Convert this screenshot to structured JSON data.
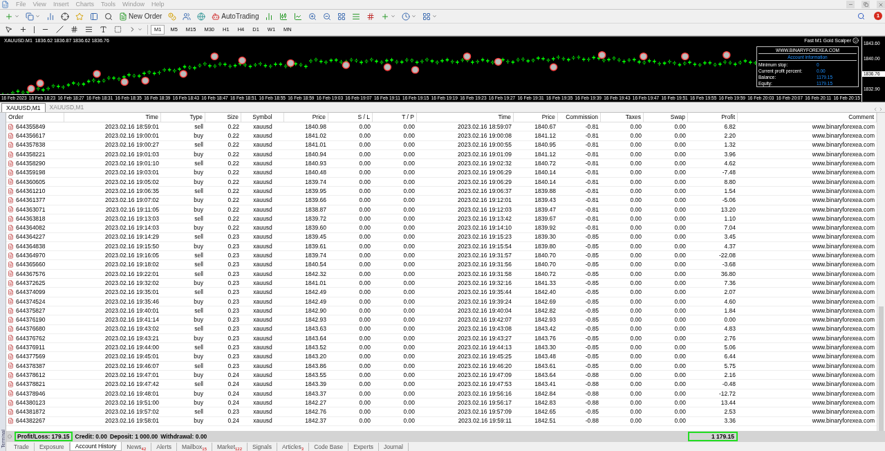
{
  "menu": [
    {
      "label": "File"
    },
    {
      "label": "View"
    },
    {
      "label": "Insert"
    },
    {
      "label": "Charts"
    },
    {
      "label": "Tools"
    },
    {
      "label": "Window"
    },
    {
      "label": "Help"
    }
  ],
  "notifications": {
    "count": "1"
  },
  "toolbar": {
    "new_order": "New Order",
    "auto_trading": "AutoTrading"
  },
  "timeframes": [
    {
      "label": "M1",
      "selected": true
    },
    {
      "label": "M5",
      "selected": false
    },
    {
      "label": "M15",
      "selected": false
    },
    {
      "label": "M30",
      "selected": false
    },
    {
      "label": "H1",
      "selected": false
    },
    {
      "label": "H4",
      "selected": false
    },
    {
      "label": "D1",
      "selected": false
    },
    {
      "label": "W1",
      "selected": false
    },
    {
      "label": "MN",
      "selected": false
    }
  ],
  "chart": {
    "header": "XAUUSD.M1  1836.62 1836.87 1836.62 1836.76",
    "expert": "Fast M1 Gold Scalper",
    "prices": [
      {
        "label": "1843.60",
        "current": false
      },
      {
        "label": "1840.00",
        "current": false
      },
      {
        "label": "1836.76",
        "current": true
      },
      {
        "label": "1832.90",
        "current": false
      }
    ],
    "times": [
      "16 Feb 2023",
      "16 Feb 18:23",
      "16 Feb 18:27",
      "16 Feb 18:31",
      "16 Feb 18:35",
      "16 Feb 18:39",
      "16 Feb 18:43",
      "16 Feb 18:47",
      "16 Feb 18:51",
      "16 Feb 18:55",
      "16 Feb 18:59",
      "16 Feb 19:03",
      "16 Feb 19:07",
      "16 Feb 19:11",
      "16 Feb 19:15",
      "16 Feb 19:19",
      "16 Feb 19:23",
      "16 Feb 19:27",
      "16 Feb 19:31",
      "16 Feb 19:35",
      "16 Feb 19:39",
      "16 Feb 19:43",
      "16 Feb 19:47",
      "16 Feb 19:51",
      "16 Feb 19:55",
      "16 Feb 19:59",
      "16 Feb 20:03",
      "16 Feb 20:07",
      "16 Feb 20:11",
      "16 Feb 20:15"
    ],
    "panel": {
      "site": "WWW.BINARYFOREXEA.COM",
      "heading": "Account information",
      "fields": [
        {
          "label": "Minimum stop:",
          "value": "0"
        },
        {
          "label": "Current profit percent:",
          "value": "0.00"
        },
        {
          "label": "Balance:",
          "value": "1179.15"
        },
        {
          "label": "Equity:",
          "value": "1179.15"
        }
      ]
    }
  },
  "chart_tabs": [
    {
      "label": "XAUUSD,M1",
      "selected": true
    },
    {
      "label": "XAUUSD,M1",
      "selected": false
    }
  ],
  "table": {
    "columns": [
      "Order",
      "Time",
      "Type",
      "Size",
      "Symbol",
      "Price",
      "S / L",
      "T / P",
      "Time",
      "Price",
      "Commission",
      "Taxes",
      "Swap",
      "Profit",
      "Comment"
    ],
    "rows": [
      [
        "644355849",
        "2023.02.16 18:59:01",
        "sell",
        "0.22",
        "xauusd",
        "1840.98",
        "0.00",
        "0.00",
        "2023.02.16 18:59:07",
        "1840.67",
        "-0.81",
        "0.00",
        "0.00",
        "6.82",
        "www.binaryforexea.com"
      ],
      [
        "644356617",
        "2023.02.16 19:00:01",
        "buy",
        "0.22",
        "xauusd",
        "1841.02",
        "0.00",
        "0.00",
        "2023.02.16 19:00:08",
        "1841.12",
        "-0.81",
        "0.00",
        "0.00",
        "2.20",
        "www.binaryforexea.com"
      ],
      [
        "644357838",
        "2023.02.16 19:00:27",
        "sell",
        "0.22",
        "xauusd",
        "1841.01",
        "0.00",
        "0.00",
        "2023.02.16 19:00:55",
        "1840.95",
        "-0.81",
        "0.00",
        "0.00",
        "1.32",
        "www.binaryforexea.com"
      ],
      [
        "644358221",
        "2023.02.16 19:01:03",
        "buy",
        "0.22",
        "xauusd",
        "1840.94",
        "0.00",
        "0.00",
        "2023.02.16 19:01:09",
        "1841.12",
        "-0.81",
        "0.00",
        "0.00",
        "3.96",
        "www.binaryforexea.com"
      ],
      [
        "644358290",
        "2023.02.16 19:01:10",
        "sell",
        "0.22",
        "xauusd",
        "1840.93",
        "0.00",
        "0.00",
        "2023.02.16 19:02:32",
        "1840.72",
        "-0.81",
        "0.00",
        "0.00",
        "4.62",
        "www.binaryforexea.com"
      ],
      [
        "644359198",
        "2023.02.16 19:03:01",
        "buy",
        "0.22",
        "xauusd",
        "1840.48",
        "0.00",
        "0.00",
        "2023.02.16 19:06:29",
        "1840.14",
        "-0.81",
        "0.00",
        "0.00",
        "-7.48",
        "www.binaryforexea.com"
      ],
      [
        "644360605",
        "2023.02.16 19:05:02",
        "buy",
        "0.22",
        "xauusd",
        "1839.74",
        "0.00",
        "0.00",
        "2023.02.16 19:06:29",
        "1840.14",
        "-0.81",
        "0.00",
        "0.00",
        "8.80",
        "www.binaryforexea.com"
      ],
      [
        "644361210",
        "2023.02.16 19:06:35",
        "sell",
        "0.22",
        "xauusd",
        "1839.95",
        "0.00",
        "0.00",
        "2023.02.16 19:06:37",
        "1839.88",
        "-0.81",
        "0.00",
        "0.00",
        "1.54",
        "www.binaryforexea.com"
      ],
      [
        "644361377",
        "2023.02.16 19:07:02",
        "buy",
        "0.22",
        "xauusd",
        "1839.66",
        "0.00",
        "0.00",
        "2023.02.16 19:12:01",
        "1839.43",
        "-0.81",
        "0.00",
        "0.00",
        "-5.06",
        "www.binaryforexea.com"
      ],
      [
        "644363071",
        "2023.02.16 19:11:05",
        "buy",
        "0.22",
        "xauusd",
        "1838.87",
        "0.00",
        "0.00",
        "2023.02.16 19:12:03",
        "1839.47",
        "-0.81",
        "0.00",
        "0.00",
        "13.20",
        "www.binaryforexea.com"
      ],
      [
        "644363818",
        "2023.02.16 19:13:03",
        "sell",
        "0.22",
        "xauusd",
        "1839.72",
        "0.00",
        "0.00",
        "2023.02.16 19:13:42",
        "1839.67",
        "-0.81",
        "0.00",
        "0.00",
        "1.10",
        "www.binaryforexea.com"
      ],
      [
        "644364082",
        "2023.02.16 19:14:03",
        "buy",
        "0.22",
        "xauusd",
        "1839.60",
        "0.00",
        "0.00",
        "2023.02.16 19:14:10",
        "1839.92",
        "-0.81",
        "0.00",
        "0.00",
        "7.04",
        "www.binaryforexea.com"
      ],
      [
        "644364227",
        "2023.02.16 19:14:29",
        "sell",
        "0.23",
        "xauusd",
        "1839.45",
        "0.00",
        "0.00",
        "2023.02.16 19:15:23",
        "1839.30",
        "-0.85",
        "0.00",
        "0.00",
        "3.45",
        "www.binaryforexea.com"
      ],
      [
        "644364838",
        "2023.02.16 19:15:50",
        "buy",
        "0.23",
        "xauusd",
        "1839.61",
        "0.00",
        "0.00",
        "2023.02.16 19:15:54",
        "1839.80",
        "-0.85",
        "0.00",
        "0.00",
        "4.37",
        "www.binaryforexea.com"
      ],
      [
        "644364970",
        "2023.02.16 19:16:05",
        "sell",
        "0.23",
        "xauusd",
        "1839.74",
        "0.00",
        "0.00",
        "2023.02.16 19:31:57",
        "1840.70",
        "-0.85",
        "0.00",
        "0.00",
        "-22.08",
        "www.binaryforexea.com"
      ],
      [
        "644365660",
        "2023.02.16 19:18:02",
        "sell",
        "0.23",
        "xauusd",
        "1840.54",
        "0.00",
        "0.00",
        "2023.02.16 19:31:56",
        "1840.70",
        "-0.85",
        "0.00",
        "0.00",
        "-3.68",
        "www.binaryforexea.com"
      ],
      [
        "644367576",
        "2023.02.16 19:22:01",
        "sell",
        "0.23",
        "xauusd",
        "1842.32",
        "0.00",
        "0.00",
        "2023.02.16 19:31:58",
        "1840.72",
        "-0.85",
        "0.00",
        "0.00",
        "36.80",
        "www.binaryforexea.com"
      ],
      [
        "644372625",
        "2023.02.16 19:32:02",
        "buy",
        "0.23",
        "xauusd",
        "1841.01",
        "0.00",
        "0.00",
        "2023.02.16 19:32:16",
        "1841.33",
        "-0.85",
        "0.00",
        "0.00",
        "7.36",
        "www.binaryforexea.com"
      ],
      [
        "644374099",
        "2023.02.16 19:35:01",
        "sell",
        "0.23",
        "xauusd",
        "1842.49",
        "0.00",
        "0.00",
        "2023.02.16 19:35:44",
        "1842.40",
        "-0.85",
        "0.00",
        "0.00",
        "2.07",
        "www.binaryforexea.com"
      ],
      [
        "644374524",
        "2023.02.16 19:35:46",
        "buy",
        "0.23",
        "xauusd",
        "1842.49",
        "0.00",
        "0.00",
        "2023.02.16 19:39:24",
        "1842.69",
        "-0.85",
        "0.00",
        "0.00",
        "4.60",
        "www.binaryforexea.com"
      ],
      [
        "644375827",
        "2023.02.16 19:40:01",
        "sell",
        "0.23",
        "xauusd",
        "1842.90",
        "0.00",
        "0.00",
        "2023.02.16 19:40:04",
        "1842.82",
        "-0.85",
        "0.00",
        "0.00",
        "1.84",
        "www.binaryforexea.com"
      ],
      [
        "644376190",
        "2023.02.16 19:41:14",
        "buy",
        "0.23",
        "xauusd",
        "1842.93",
        "0.00",
        "0.00",
        "2023.02.16 19:42:07",
        "1842.93",
        "-0.85",
        "0.00",
        "0.00",
        "0.00",
        "www.binaryforexea.com"
      ],
      [
        "644376680",
        "2023.02.16 19:43:02",
        "sell",
        "0.23",
        "xauusd",
        "1843.63",
        "0.00",
        "0.00",
        "2023.02.16 19:43:08",
        "1843.42",
        "-0.85",
        "0.00",
        "0.00",
        "4.83",
        "www.binaryforexea.com"
      ],
      [
        "644376762",
        "2023.02.16 19:43:21",
        "buy",
        "0.23",
        "xauusd",
        "1843.64",
        "0.00",
        "0.00",
        "2023.02.16 19:43:27",
        "1843.76",
        "-0.85",
        "0.00",
        "0.00",
        "2.76",
        "www.binaryforexea.com"
      ],
      [
        "644376911",
        "2023.02.16 19:44:00",
        "sell",
        "0.23",
        "xauusd",
        "1843.52",
        "0.00",
        "0.00",
        "2023.02.16 19:44:13",
        "1843.30",
        "-0.85",
        "0.00",
        "0.00",
        "5.06",
        "www.binaryforexea.com"
      ],
      [
        "644377569",
        "2023.02.16 19:45:01",
        "buy",
        "0.23",
        "xauusd",
        "1843.20",
        "0.00",
        "0.00",
        "2023.02.16 19:45:25",
        "1843.48",
        "-0.85",
        "0.00",
        "0.00",
        "6.44",
        "www.binaryforexea.com"
      ],
      [
        "644378387",
        "2023.02.16 19:46:07",
        "sell",
        "0.23",
        "xauusd",
        "1843.86",
        "0.00",
        "0.00",
        "2023.02.16 19:46:20",
        "1843.61",
        "-0.85",
        "0.00",
        "0.00",
        "5.75",
        "www.binaryforexea.com"
      ],
      [
        "644378612",
        "2023.02.16 19:47:01",
        "buy",
        "0.24",
        "xauusd",
        "1843.55",
        "0.00",
        "0.00",
        "2023.02.16 19:47:09",
        "1843.64",
        "-0.88",
        "0.00",
        "0.00",
        "2.16",
        "www.binaryforexea.com"
      ],
      [
        "644378821",
        "2023.02.16 19:47:42",
        "sell",
        "0.24",
        "xauusd",
        "1843.39",
        "0.00",
        "0.00",
        "2023.02.16 19:47:53",
        "1843.41",
        "-0.88",
        "0.00",
        "0.00",
        "-0.48",
        "www.binaryforexea.com"
      ],
      [
        "644378946",
        "2023.02.16 19:48:01",
        "buy",
        "0.24",
        "xauusd",
        "1843.37",
        "0.00",
        "0.00",
        "2023.02.16 19:56:16",
        "1842.84",
        "-0.88",
        "0.00",
        "0.00",
        "-12.72",
        "www.binaryforexea.com"
      ],
      [
        "644380123",
        "2023.02.16 19:51:00",
        "buy",
        "0.24",
        "xauusd",
        "1842.27",
        "0.00",
        "0.00",
        "2023.02.16 19:56:17",
        "1842.83",
        "-0.88",
        "0.00",
        "0.00",
        "13.44",
        "www.binaryforexea.com"
      ],
      [
        "644381872",
        "2023.02.16 19:57:02",
        "sell",
        "0.23",
        "xauusd",
        "1842.76",
        "0.00",
        "0.00",
        "2023.02.16 19:57:09",
        "1842.65",
        "-0.85",
        "0.00",
        "0.00",
        "2.53",
        "www.binaryforexea.com"
      ],
      [
        "644382267",
        "2023.02.16 19:58:01",
        "buy",
        "0.24",
        "xauusd",
        "1842.37",
        "0.00",
        "0.00",
        "2023.02.16 19:59:11",
        "1842.51",
        "-0.88",
        "0.00",
        "0.00",
        "3.36",
        "www.binaryforexea.com"
      ]
    ]
  },
  "summary": {
    "profit_loss": "Profit/Loss: 179.15",
    "items": [
      "Credit: 0.00",
      "Deposit: 1 000.00",
      "Withdrawal: 0.00"
    ],
    "total": "1 179.15"
  },
  "terminal_label": "Terminal",
  "bottom_tabs": [
    {
      "label": "Trade",
      "selected": false
    },
    {
      "label": "Exposure",
      "selected": false
    },
    {
      "label": "Account History",
      "selected": true
    },
    {
      "label": "News",
      "count": "42",
      "selected": false
    },
    {
      "label": "Alerts",
      "selected": false
    },
    {
      "label": "Mailbox",
      "count": "15",
      "selected": false
    },
    {
      "label": "Market",
      "count": "122",
      "selected": false
    },
    {
      "label": "Signals",
      "selected": false
    },
    {
      "label": "Articles",
      "count": "3",
      "selected": false
    },
    {
      "label": "Code Base",
      "selected": false
    },
    {
      "label": "Experts",
      "selected": false
    },
    {
      "label": "Journal",
      "selected": false
    }
  ]
}
